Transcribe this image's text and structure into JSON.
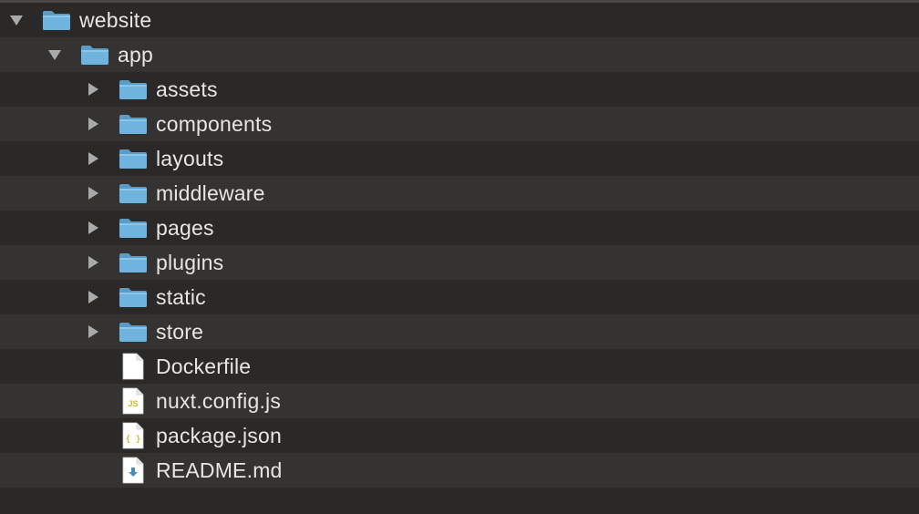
{
  "colors": {
    "background_odd": "#2b2928",
    "background_even": "#353331",
    "text": "#e8e6e3",
    "folder_blue": "#6fb4de",
    "disclosure": "#aaaaaa"
  },
  "tree": {
    "rows": [
      {
        "label": "website",
        "kind": "folder",
        "depth": 0,
        "disclosure": "expanded"
      },
      {
        "label": "app",
        "kind": "folder",
        "depth": 1,
        "disclosure": "expanded"
      },
      {
        "label": "assets",
        "kind": "folder",
        "depth": 2,
        "disclosure": "collapsed"
      },
      {
        "label": "components",
        "kind": "folder",
        "depth": 2,
        "disclosure": "collapsed"
      },
      {
        "label": "layouts",
        "kind": "folder",
        "depth": 2,
        "disclosure": "collapsed"
      },
      {
        "label": "middleware",
        "kind": "folder",
        "depth": 2,
        "disclosure": "collapsed"
      },
      {
        "label": "pages",
        "kind": "folder",
        "depth": 2,
        "disclosure": "collapsed"
      },
      {
        "label": "plugins",
        "kind": "folder",
        "depth": 2,
        "disclosure": "collapsed"
      },
      {
        "label": "static",
        "kind": "folder",
        "depth": 2,
        "disclosure": "collapsed"
      },
      {
        "label": "store",
        "kind": "folder",
        "depth": 2,
        "disclosure": "collapsed"
      },
      {
        "label": "Dockerfile",
        "kind": "file-blank",
        "depth": 2,
        "disclosure": "none"
      },
      {
        "label": "nuxt.config.js",
        "kind": "file-js",
        "depth": 2,
        "disclosure": "none",
        "badge": "JS"
      },
      {
        "label": "package.json",
        "kind": "file-json",
        "depth": 2,
        "disclosure": "none",
        "badge": "{ }"
      },
      {
        "label": "README.md",
        "kind": "file-md",
        "depth": 2,
        "disclosure": "none"
      }
    ]
  }
}
